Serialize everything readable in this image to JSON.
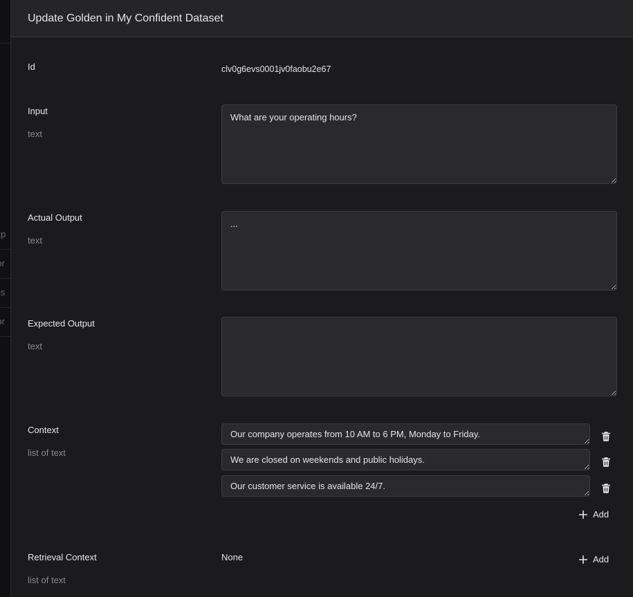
{
  "background": {
    "rows": [
      "Exp",
      "Nor",
      "Yes",
      "Nor"
    ]
  },
  "dialog": {
    "title": "Update Golden in My Confident Dataset"
  },
  "fields": {
    "id": {
      "label": "Id",
      "value": "clv0g6evs0001jv0faobu2e67"
    },
    "input": {
      "label": "Input",
      "type": "text",
      "value": "What are your operating hours?"
    },
    "actual_output": {
      "label": "Actual Output",
      "type": "text",
      "value": "..."
    },
    "expected_output": {
      "label": "Expected Output",
      "type": "text",
      "value": ""
    },
    "context": {
      "label": "Context",
      "type": "list of text",
      "items": [
        "Our company operates from 10 AM to 6 PM, Monday to Friday.",
        "We are closed on weekends and public holidays.",
        "Our customer service is available 24/7."
      ],
      "add_label": "Add"
    },
    "retrieval_context": {
      "label": "Retrieval Context",
      "type": "list of text",
      "value": "None",
      "add_label": "Add"
    }
  },
  "icons": {
    "delete": "trash-icon",
    "add": "plus-icon"
  },
  "colors": {
    "drawer_bg": "#1b1b1d",
    "header_bg": "#252527",
    "input_bg": "#2a2a2d",
    "text": "#e6e6e8",
    "muted": "#8a8a8f"
  }
}
